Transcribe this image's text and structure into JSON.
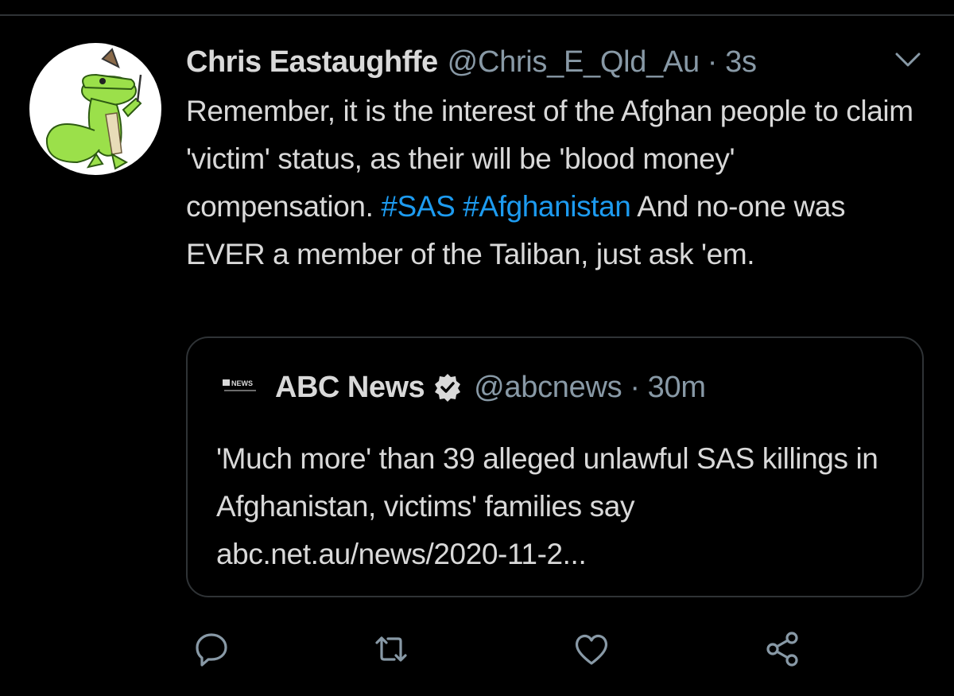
{
  "tweet": {
    "display_name": "Chris Eastaughffe",
    "handle": "@Chris_E_Qld_Au",
    "separator": "·",
    "time": "3s",
    "text_parts": [
      "Remember, it is the interest of the Afghan people to claim 'victim' status, as their will be 'blood money' compensation. ",
      "#SAS",
      " ",
      "#Afghanistan",
      " And no-one was EVER a member of the Taliban, just ask 'em."
    ]
  },
  "quoted_tweet": {
    "logo_text": "ABC NEWS",
    "display_name": "ABC News",
    "handle": "@abcnews",
    "separator": "·",
    "time": "30m",
    "text": "'Much more' than 39 alleged unlawful SAS killings in Afghanistan, victims' families say abc.net.au/news/2020-11-2..."
  },
  "icons": {
    "menu": "chevron-down-icon",
    "reply": "reply-icon",
    "retweet": "retweet-icon",
    "like": "heart-icon",
    "share": "share-icon",
    "verified": "verified-badge-icon"
  },
  "colors": {
    "background": "#000000",
    "text": "#d9d9d9",
    "secondary": "#8899a6",
    "hashtag": "#1d9bf0",
    "border": "#2f3336"
  }
}
